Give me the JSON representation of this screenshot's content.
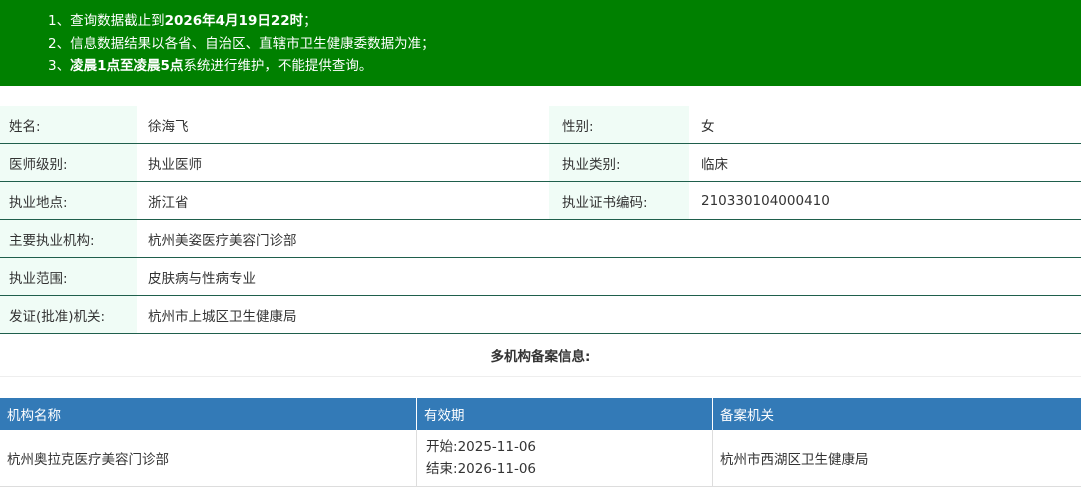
{
  "notice": {
    "line1_prefix": "1、查询数据截止到",
    "line1_bold": "2026年4月19日22时",
    "line1_suffix": "；",
    "line2": "2、信息数据结果以各省、自治区、直辖市卫生健康委数据为准；",
    "line3_prefix": "3、",
    "line3_bold": "凌晨1点至凌晨5点",
    "line3_suffix": "系统进行维护，不能提供查询。"
  },
  "doctor": {
    "name_label": "姓名:",
    "name": "徐海飞",
    "gender_label": "性别:",
    "gender": "女",
    "level_label": "医师级别:",
    "level": "执业医师",
    "category_label": "执业类别:",
    "category": "临床",
    "location_label": "执业地点:",
    "location": "浙江省",
    "cert_label": "执业证书编码:",
    "cert_no": "210330104000410",
    "institution_label": "主要执业机构:",
    "institution": "杭州美姿医疗美容门诊部",
    "scope_label": "执业范围:",
    "scope": "皮肤病与性病专业",
    "authority_label": "发证(批准)机关:",
    "authority": "杭州市上城区卫生健康局"
  },
  "multi": {
    "title": "多机构备案信息:",
    "headers": [
      "机构名称",
      "有效期",
      "备案机关"
    ],
    "rows": [
      {
        "institution": "杭州奥拉克医疗美容门诊部",
        "start_label": "开始:",
        "start": "2025-11-06",
        "end_label": "结束:",
        "end": "2026-11-06",
        "authority": "杭州市西湖区卫生健康局"
      }
    ]
  },
  "colors": {
    "notice_bg": "#008000",
    "label_bg": "#f0fcf6",
    "table_header_bg": "#337ab7",
    "row_border": "#1f5f4c"
  }
}
